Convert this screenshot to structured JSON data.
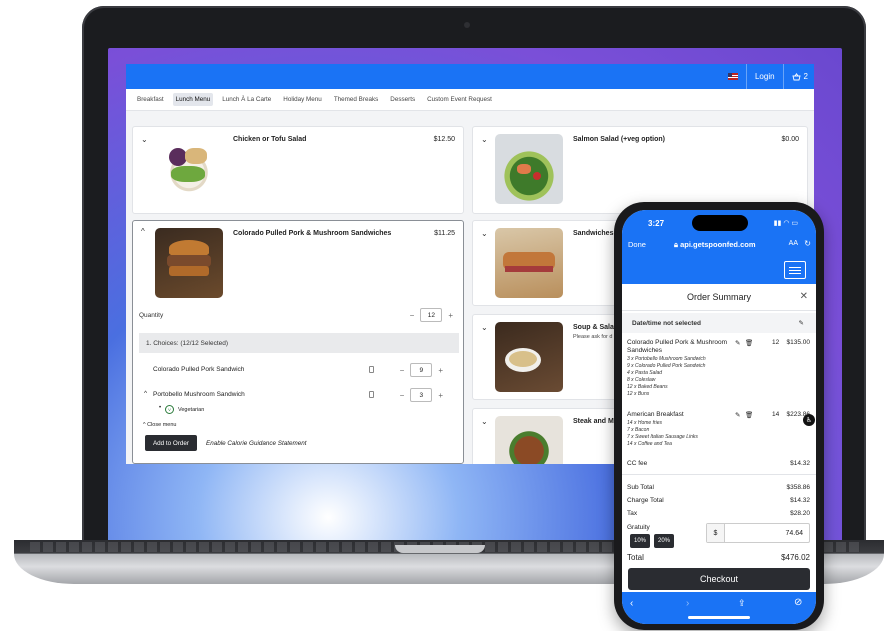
{
  "header": {
    "login_label": "Login",
    "cart_count": "2",
    "flag_icon": "us-flag-icon",
    "cart_icon": "basket-icon"
  },
  "tabs": [
    "Breakfast",
    "Lunch Menu",
    "Lunch À La Carte",
    "Holiday Menu",
    "Themed Breaks",
    "Desserts",
    "Custom Event Request"
  ],
  "active_tab": "Lunch Menu",
  "menu_items": [
    {
      "name": "Chicken or Tofu Salad",
      "price": "$12.50"
    },
    {
      "name": "Salmon Salad (+veg option)",
      "price": "$0.00"
    },
    {
      "name": "Colorado Pulled Pork & Mushroom Sandwiches",
      "price": "$11.25"
    },
    {
      "name": "Sandwiches",
      "price": ""
    },
    {
      "name": "Soup & Salad",
      "price": "",
      "subtitle": "Please ask for d"
    },
    {
      "name": "Steak and M",
      "price": ""
    }
  ],
  "expanded": {
    "quantity_label": "Quantity",
    "quantity": "12",
    "choices_label": "1. Choices:  (12/12 Selected)",
    "choices": [
      {
        "name": "Colorado Pulled Pork Sandwich",
        "qty": "9"
      },
      {
        "name": "Portobello Mushroom Sandwich",
        "qty": "3",
        "tag": "Vegetarian"
      }
    ],
    "close_label": "Close menu",
    "add_label": "Add to Order",
    "calorie_label": "Enable Calorie Guidance Statement"
  },
  "phone": {
    "time": "3:27",
    "done_label": "Done",
    "url": "api.getspoonfed.com",
    "aa_label": "AA",
    "order_summary": {
      "title": "Order Summary",
      "datetime": "Date/time not selected",
      "items": [
        {
          "name": "Colorado Pulled Pork & Mushroom Sandwiches",
          "qty": "12",
          "price": "$135.00",
          "lines": [
            "3 x Portobello Mushroom Sandwich",
            "9 x Colorado Pulled Pork Sandwich",
            "4 x Pasta Salad",
            "8 x Coleslaw",
            "12 x Baked Beans",
            "12 x Buns"
          ]
        },
        {
          "name": "American Breakfast",
          "qty": "14",
          "price": "$223.86",
          "lines": [
            "14 x Home fries",
            "7 x Bacon",
            "7 x Sweet Italian Sausage Links",
            "14 x Coffee and Tea"
          ]
        }
      ],
      "cc_fee_label": "CC fee",
      "cc_fee": "$14.32",
      "subtotal_label": "Sub Total",
      "subtotal": "$358.86",
      "charge_total_label": "Charge Total",
      "charge_total": "$14.32",
      "tax_label": "Tax",
      "tax": "$28.20",
      "gratuity_label": "Gratuity",
      "gratuity_options": [
        "10%",
        "20%"
      ],
      "gratuity_sign": "$",
      "gratuity_value": "74.64",
      "total_label": "Total",
      "total": "$476.02",
      "checkout_label": "Checkout"
    }
  },
  "colors": {
    "accent": "#1a73f5",
    "dark_button": "#2a2c31"
  }
}
